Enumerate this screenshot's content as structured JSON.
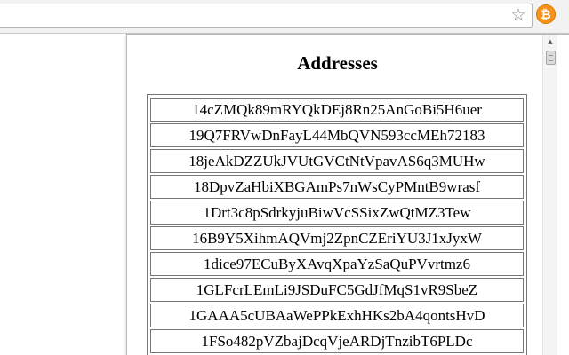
{
  "browser": {
    "bookmark_icon": "star-icon",
    "extension_icon": "bitcoin-icon",
    "extension_glyph": "₿"
  },
  "popup": {
    "title": "Addresses",
    "addresses": [
      "14cZMQk89mRYQkDEj8Rn25AnGoBi5H6uer",
      "19Q7FRVwDnFayL44MbQVN593ccMEh72183",
      "18jeAkDZZUkJVUtGVCtNtVpavAS6q3MUHw",
      "18DpvZaHbiXBGAmPs7nWsCyPMntB9wrasf",
      "1Drt3c8pSdrkyjuBiwVcSSixZwQtMZ3Tew",
      "16B9Y5XihmAQVmj2ZpnCZEriYU3J1xJyxW",
      "1dice97ECuByXAvqXpaYzSaQuPVvrtmz6",
      "1GLFcrLEmLi9JSDuFC5GdJfMqS1vR9SbeZ",
      "1GAAA5cUBAaWePPkExhHKs2bA4qontsHvD",
      "1FSo482pVZbajDcqVjeARDjTnzibT6PLDc"
    ]
  },
  "colors": {
    "bitcoin_orange": "#f7931a"
  }
}
